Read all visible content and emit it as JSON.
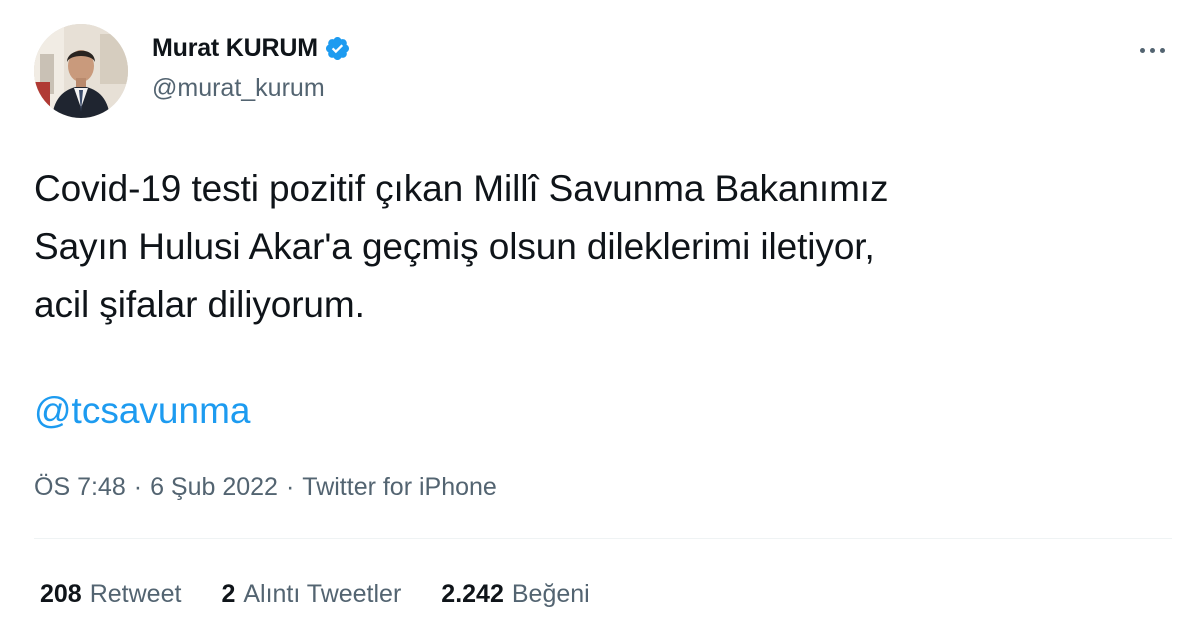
{
  "author": {
    "display_name": "Murat KURUM",
    "handle": "@murat_kurum",
    "verified": true
  },
  "tweet": {
    "text": "Covid-19 testi pozitif çıkan Millî Savunma Bakanımız\nSayın Hulusi Akar'a geçmiş olsun dileklerimi iletiyor,\nacil şifalar diliyorum.",
    "mention": "@tcsavunma"
  },
  "meta": {
    "time": "ÖS 7:48",
    "date": "6 Şub 2022",
    "source": "Twitter for iPhone",
    "separator": "·"
  },
  "stats": {
    "retweets": {
      "count": "208",
      "label": "Retweet"
    },
    "quotes": {
      "count": "2",
      "label": "Alıntı Tweetler"
    },
    "likes": {
      "count": "2.242",
      "label": "Beğeni"
    }
  },
  "colors": {
    "text": "#0f1419",
    "secondary": "#536471",
    "link": "#1d9bf0",
    "verified_badge": "#1d9bf0",
    "divider": "#eff3f4"
  },
  "icons": {
    "verified": "verified-badge-icon",
    "more": "more-options-icon"
  }
}
